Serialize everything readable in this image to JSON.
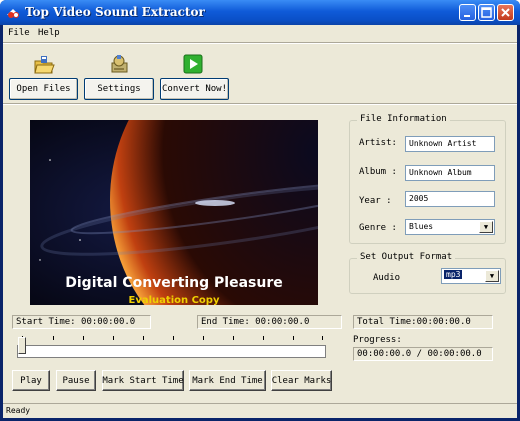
{
  "window": {
    "title": "Top Video Sound Extractor"
  },
  "menu": {
    "items": [
      "File",
      "Help"
    ]
  },
  "toolbar": {
    "open_files": "Open Files",
    "settings": "Settings",
    "convert_now": "Convert Now!"
  },
  "video": {
    "caption": "Digital Converting Pleasure",
    "watermark": "Evaluation Copy"
  },
  "file_info": {
    "title": "File Information",
    "artist_label": "Artist:",
    "artist_value": "Unknown Artist",
    "album_label": "Album :",
    "album_value": "Unknown Album",
    "year_label": "Year :",
    "year_value": "2005",
    "genre_label": "Genre :",
    "genre_value": "Blues"
  },
  "output": {
    "title": "Set Output Format",
    "audio_label": "Audio",
    "audio_value": "mp3"
  },
  "times": {
    "start": "Start Time: 00:00:00.0",
    "end": "End Time:  00:00:00.0",
    "total": "Total Time:00:00:00.0",
    "progress_label": "Progress:",
    "progress_value": "00:00:00.0 / 00:00:00.0"
  },
  "controls": {
    "play": "Play",
    "pause": "Pause",
    "mark_start": "Mark Start Time",
    "mark_end": "Mark End Time",
    "clear_marks": "Clear Marks"
  },
  "status": {
    "text": "Ready"
  },
  "colors": {
    "titlebar": "#0f5bd8",
    "face": "#ece9d8",
    "selection": "#0a246a"
  }
}
